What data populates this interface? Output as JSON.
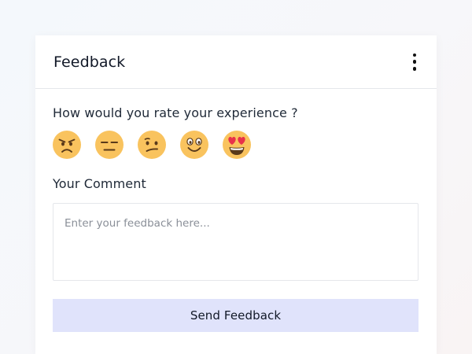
{
  "card": {
    "title": "Feedback",
    "menu_icon": "more-vertical-icon"
  },
  "rating": {
    "question": "How would you rate your experience ?",
    "options": [
      {
        "icon": "angry-face-icon"
      },
      {
        "icon": "expressionless-face-icon"
      },
      {
        "icon": "confused-face-icon"
      },
      {
        "icon": "slightly-smiling-face-icon"
      },
      {
        "icon": "heart-eyes-face-icon"
      }
    ]
  },
  "comment": {
    "label": "Your Comment",
    "placeholder": "Enter your feedback here...",
    "value": ""
  },
  "submit": {
    "label": "Send Feedback"
  },
  "colors": {
    "emoji_face": "#f9c35e",
    "emoji_feature": "#5a3a1a",
    "heart": "#e8314a",
    "button_bg": "#e0e3fb",
    "divider": "#e5e7eb"
  }
}
